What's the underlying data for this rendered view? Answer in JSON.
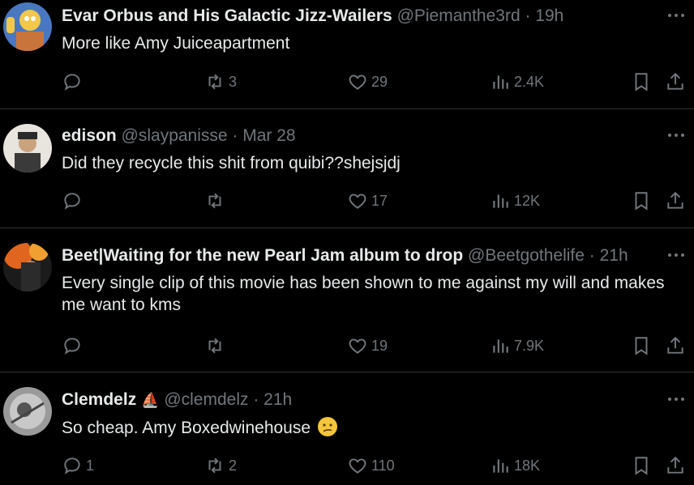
{
  "tweets": [
    {
      "name": "Evar Orbus and His Galactic Jizz-Wailers",
      "handle": "@Piemanthe3rd",
      "time": "· 19h",
      "text": "More like Amy Juiceapartment",
      "replies": "",
      "retweets": "3",
      "likes": "29",
      "views": "2.4K",
      "avatar_colors": [
        "#4a78c0",
        "#f2c84b"
      ]
    },
    {
      "name": "edison",
      "handle": "@slaypanisse",
      "time": "· Mar 28",
      "text": "Did they recycle this shit from quibi??shejsjdj",
      "replies": "",
      "retweets": "",
      "likes": "17",
      "views": "12K",
      "avatar_colors": [
        "#e8e4de",
        "#3a3a3a"
      ]
    },
    {
      "name": "Beet|Waiting for the new Pearl Jam album to drop",
      "handle": "@Beetgothelife",
      "time": "· 21h",
      "text": "Every single clip of this movie has been shown to me against my will and makes me want to kms",
      "replies": "",
      "retweets": "",
      "likes": "19",
      "views": "7.9K",
      "avatar_colors": [
        "#e0651e",
        "#1b1b1b"
      ]
    },
    {
      "name": "Clemdelz",
      "badge": "⛵",
      "handle": "@clemdelz",
      "time": "· 21h",
      "text": "So cheap. Amy Boxedwinehouse",
      "emoji": "confused-face",
      "replies": "1",
      "retweets": "2",
      "likes": "110",
      "views": "18K",
      "avatar_colors": [
        "#9a9a9a",
        "#444"
      ]
    }
  ],
  "colors": {
    "background": "#000000",
    "text": "#e7e9ea",
    "muted": "#71767b",
    "divider": "#2f3336"
  }
}
